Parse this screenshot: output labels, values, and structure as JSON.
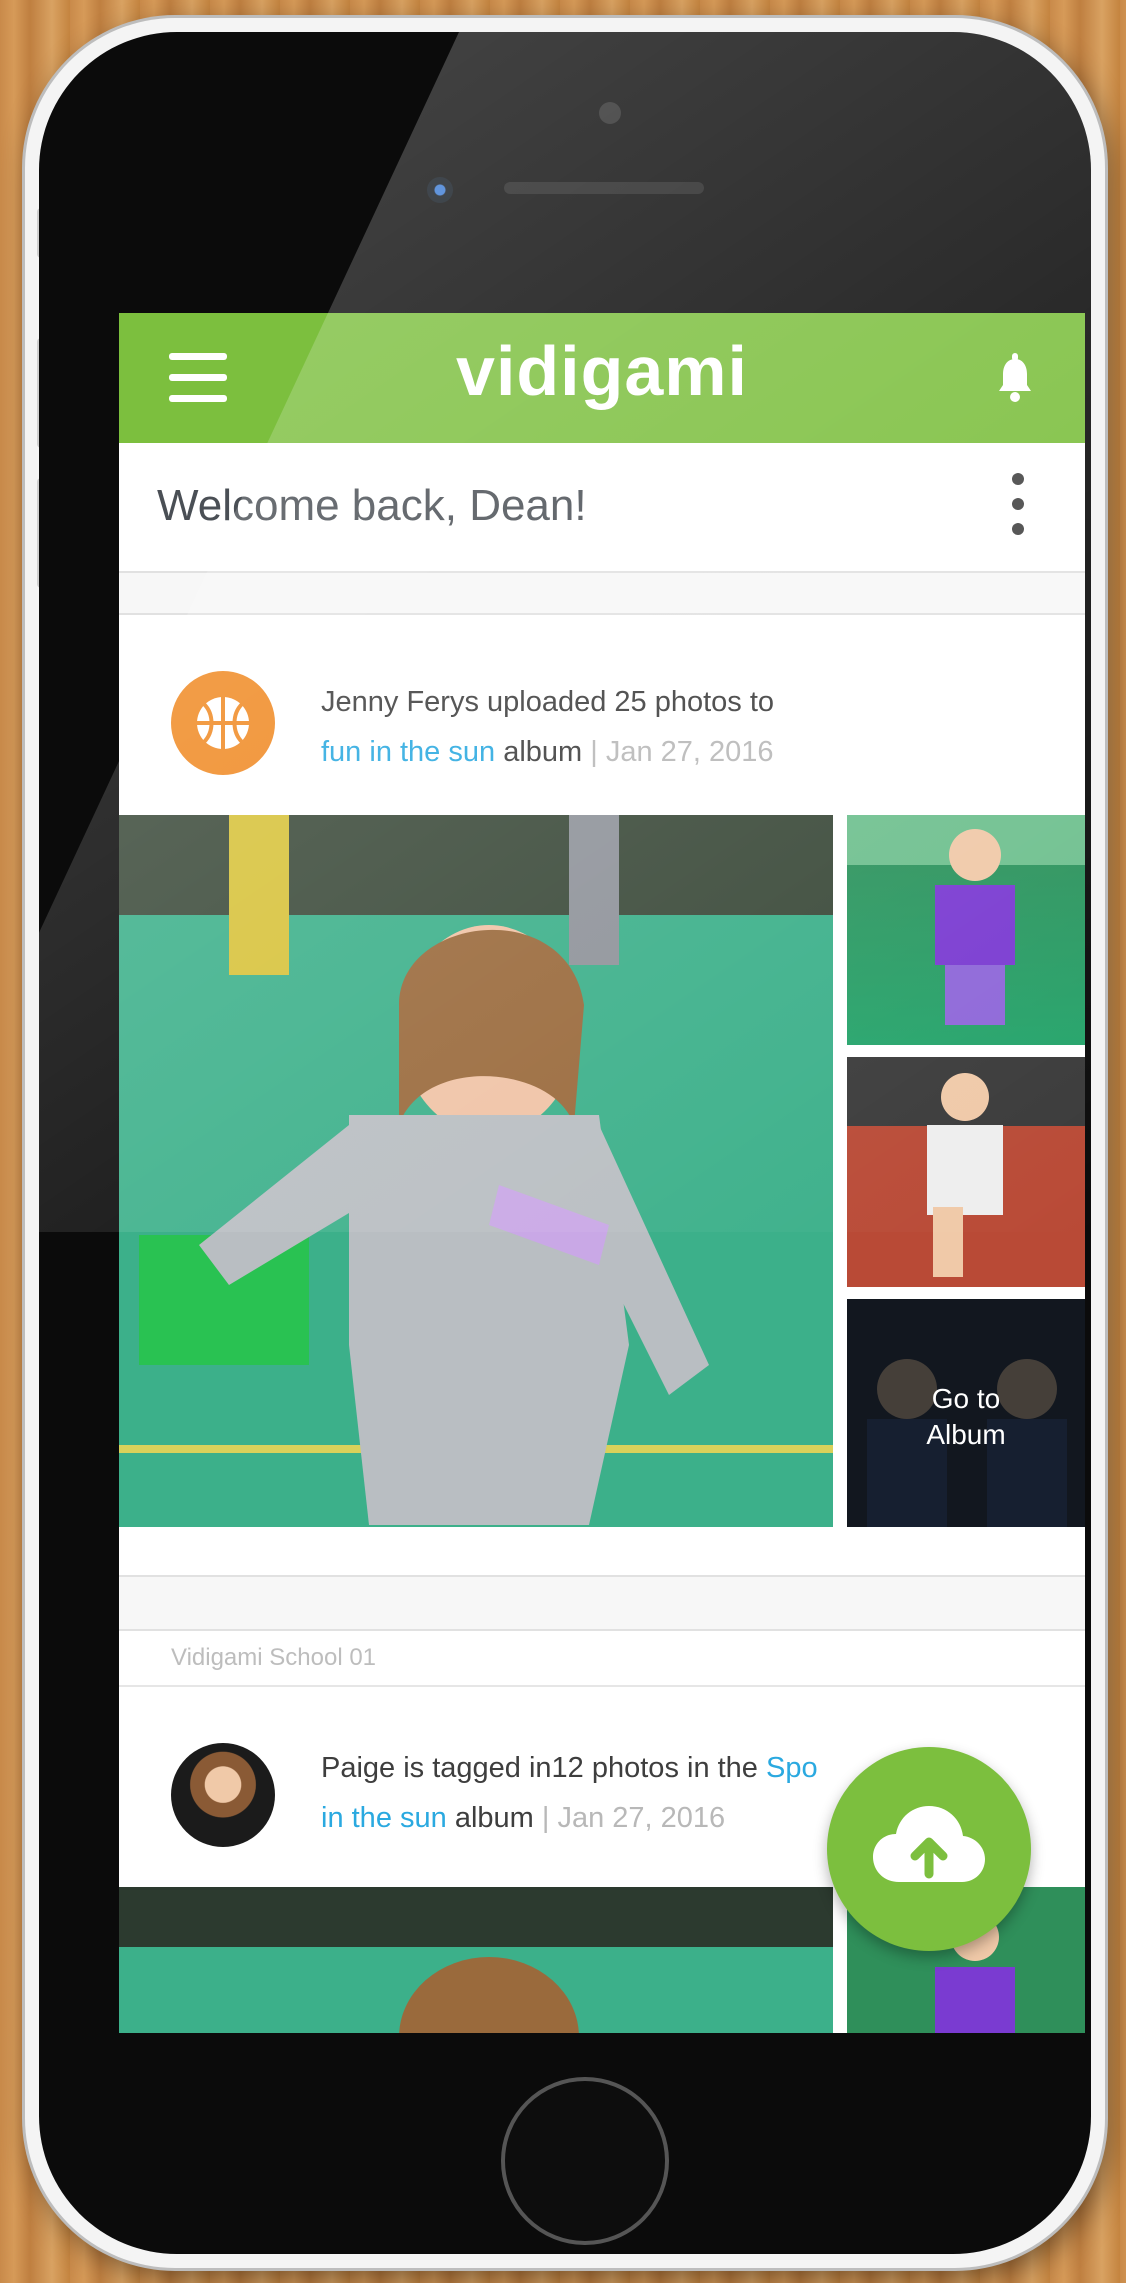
{
  "app": {
    "brand": "vidigami"
  },
  "welcome": {
    "title": "Welcome back, Dean!"
  },
  "feed": [
    {
      "text_before": "Jenny Ferys uploaded 25 photos to",
      "album_link": "fun in the sun",
      "text_after": " album",
      "separator": " | ",
      "date": "Jan 27, 2016",
      "avatar_icon": "basketball-icon",
      "tile_overlay": [
        "Go to",
        "Album"
      ]
    },
    {
      "section": "Vidigami School 01",
      "text_before": "Paige is tagged in12 photos in the ",
      "album_link_part1": "Spo",
      "album_link_part2": "in the sun",
      "text_after": " album",
      "separator": " | ",
      "date": "Jan 27, 2016"
    }
  ],
  "fab": {
    "icon": "cloud-upload-icon"
  },
  "colors": {
    "brand_green": "#7cbf3e",
    "link_blue": "#2aa9e0",
    "avatar_orange": "#f08a24"
  }
}
